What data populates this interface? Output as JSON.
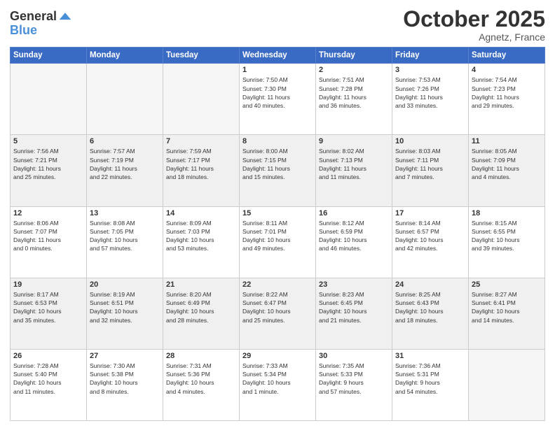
{
  "header": {
    "logo_line1": "General",
    "logo_line2": "Blue",
    "month": "October 2025",
    "location": "Agnetz, France"
  },
  "weekdays": [
    "Sunday",
    "Monday",
    "Tuesday",
    "Wednesday",
    "Thursday",
    "Friday",
    "Saturday"
  ],
  "weeks": [
    [
      {
        "day": "",
        "info": ""
      },
      {
        "day": "",
        "info": ""
      },
      {
        "day": "",
        "info": ""
      },
      {
        "day": "1",
        "info": "Sunrise: 7:50 AM\nSunset: 7:30 PM\nDaylight: 11 hours\nand 40 minutes."
      },
      {
        "day": "2",
        "info": "Sunrise: 7:51 AM\nSunset: 7:28 PM\nDaylight: 11 hours\nand 36 minutes."
      },
      {
        "day": "3",
        "info": "Sunrise: 7:53 AM\nSunset: 7:26 PM\nDaylight: 11 hours\nand 33 minutes."
      },
      {
        "day": "4",
        "info": "Sunrise: 7:54 AM\nSunset: 7:23 PM\nDaylight: 11 hours\nand 29 minutes."
      }
    ],
    [
      {
        "day": "5",
        "info": "Sunrise: 7:56 AM\nSunset: 7:21 PM\nDaylight: 11 hours\nand 25 minutes."
      },
      {
        "day": "6",
        "info": "Sunrise: 7:57 AM\nSunset: 7:19 PM\nDaylight: 11 hours\nand 22 minutes."
      },
      {
        "day": "7",
        "info": "Sunrise: 7:59 AM\nSunset: 7:17 PM\nDaylight: 11 hours\nand 18 minutes."
      },
      {
        "day": "8",
        "info": "Sunrise: 8:00 AM\nSunset: 7:15 PM\nDaylight: 11 hours\nand 15 minutes."
      },
      {
        "day": "9",
        "info": "Sunrise: 8:02 AM\nSunset: 7:13 PM\nDaylight: 11 hours\nand 11 minutes."
      },
      {
        "day": "10",
        "info": "Sunrise: 8:03 AM\nSunset: 7:11 PM\nDaylight: 11 hours\nand 7 minutes."
      },
      {
        "day": "11",
        "info": "Sunrise: 8:05 AM\nSunset: 7:09 PM\nDaylight: 11 hours\nand 4 minutes."
      }
    ],
    [
      {
        "day": "12",
        "info": "Sunrise: 8:06 AM\nSunset: 7:07 PM\nDaylight: 11 hours\nand 0 minutes."
      },
      {
        "day": "13",
        "info": "Sunrise: 8:08 AM\nSunset: 7:05 PM\nDaylight: 10 hours\nand 57 minutes."
      },
      {
        "day": "14",
        "info": "Sunrise: 8:09 AM\nSunset: 7:03 PM\nDaylight: 10 hours\nand 53 minutes."
      },
      {
        "day": "15",
        "info": "Sunrise: 8:11 AM\nSunset: 7:01 PM\nDaylight: 10 hours\nand 49 minutes."
      },
      {
        "day": "16",
        "info": "Sunrise: 8:12 AM\nSunset: 6:59 PM\nDaylight: 10 hours\nand 46 minutes."
      },
      {
        "day": "17",
        "info": "Sunrise: 8:14 AM\nSunset: 6:57 PM\nDaylight: 10 hours\nand 42 minutes."
      },
      {
        "day": "18",
        "info": "Sunrise: 8:15 AM\nSunset: 6:55 PM\nDaylight: 10 hours\nand 39 minutes."
      }
    ],
    [
      {
        "day": "19",
        "info": "Sunrise: 8:17 AM\nSunset: 6:53 PM\nDaylight: 10 hours\nand 35 minutes."
      },
      {
        "day": "20",
        "info": "Sunrise: 8:19 AM\nSunset: 6:51 PM\nDaylight: 10 hours\nand 32 minutes."
      },
      {
        "day": "21",
        "info": "Sunrise: 8:20 AM\nSunset: 6:49 PM\nDaylight: 10 hours\nand 28 minutes."
      },
      {
        "day": "22",
        "info": "Sunrise: 8:22 AM\nSunset: 6:47 PM\nDaylight: 10 hours\nand 25 minutes."
      },
      {
        "day": "23",
        "info": "Sunrise: 8:23 AM\nSunset: 6:45 PM\nDaylight: 10 hours\nand 21 minutes."
      },
      {
        "day": "24",
        "info": "Sunrise: 8:25 AM\nSunset: 6:43 PM\nDaylight: 10 hours\nand 18 minutes."
      },
      {
        "day": "25",
        "info": "Sunrise: 8:27 AM\nSunset: 6:41 PM\nDaylight: 10 hours\nand 14 minutes."
      }
    ],
    [
      {
        "day": "26",
        "info": "Sunrise: 7:28 AM\nSunset: 5:40 PM\nDaylight: 10 hours\nand 11 minutes."
      },
      {
        "day": "27",
        "info": "Sunrise: 7:30 AM\nSunset: 5:38 PM\nDaylight: 10 hours\nand 8 minutes."
      },
      {
        "day": "28",
        "info": "Sunrise: 7:31 AM\nSunset: 5:36 PM\nDaylight: 10 hours\nand 4 minutes."
      },
      {
        "day": "29",
        "info": "Sunrise: 7:33 AM\nSunset: 5:34 PM\nDaylight: 10 hours\nand 1 minute."
      },
      {
        "day": "30",
        "info": "Sunrise: 7:35 AM\nSunset: 5:33 PM\nDaylight: 9 hours\nand 57 minutes."
      },
      {
        "day": "31",
        "info": "Sunrise: 7:36 AM\nSunset: 5:31 PM\nDaylight: 9 hours\nand 54 minutes."
      },
      {
        "day": "",
        "info": ""
      }
    ]
  ]
}
